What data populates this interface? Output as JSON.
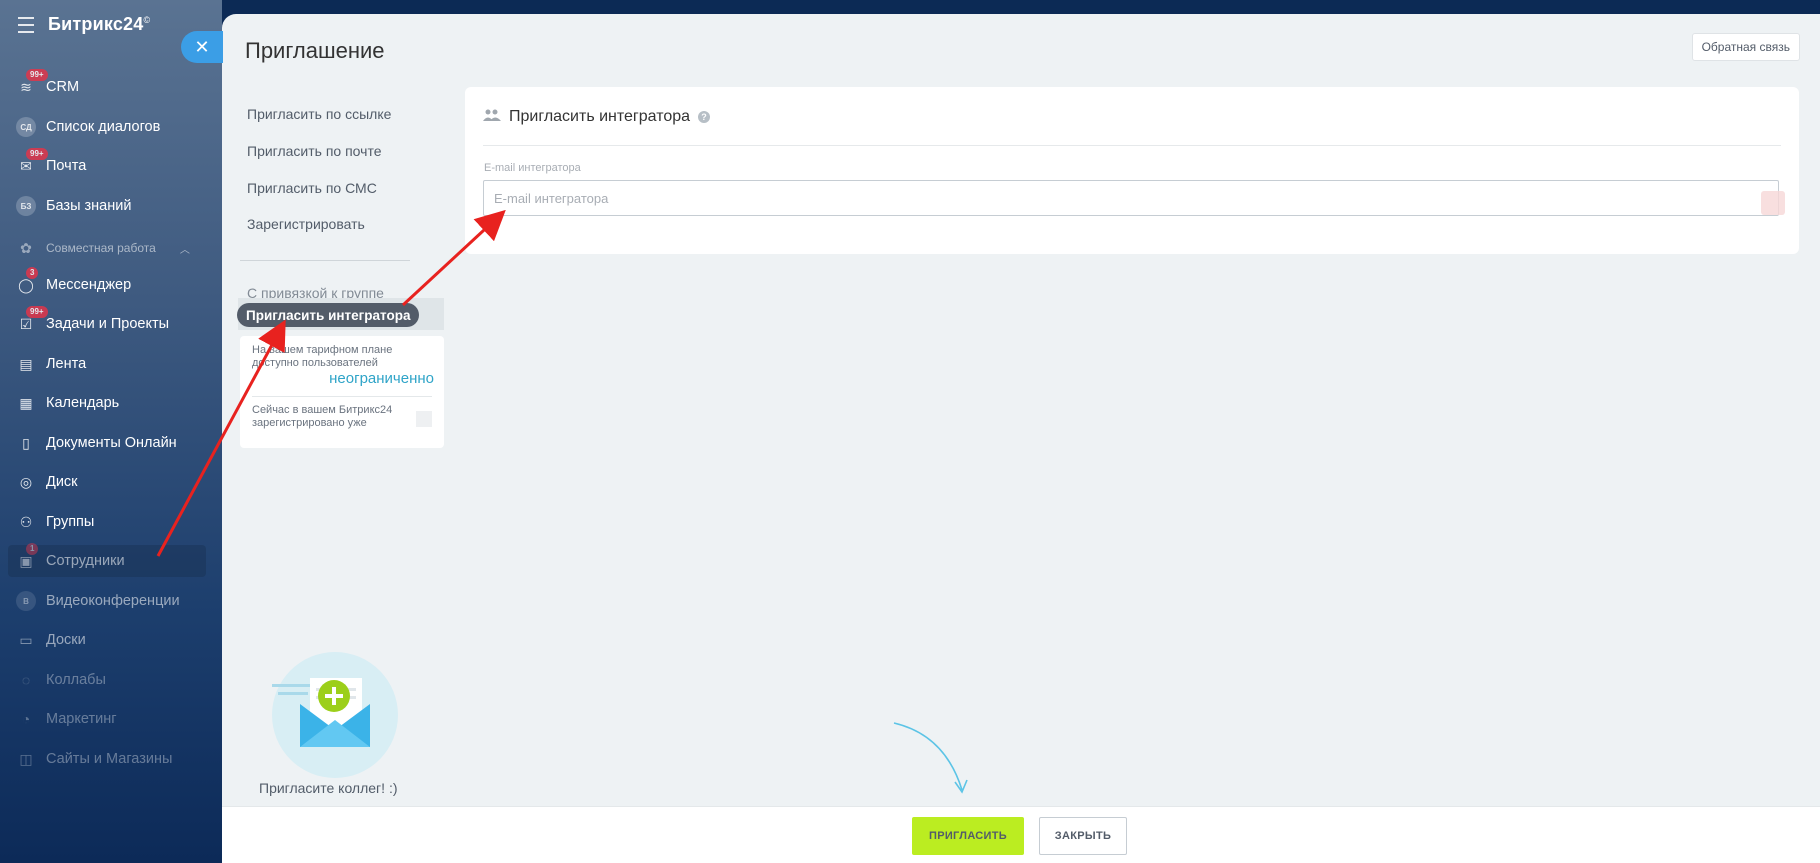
{
  "sidebar": {
    "logo": "Битрикс24",
    "logo_mark": "©",
    "items": [
      {
        "label": "CRM",
        "badge": "99+",
        "icon": "crm-icon"
      },
      {
        "label": "Список диалогов",
        "icon_text": "СД"
      },
      {
        "label": "Почта",
        "badge": "99+",
        "icon": "mail-icon"
      },
      {
        "label": "Базы знаний",
        "icon_text": "БЗ"
      },
      {
        "label": "Совместная работа",
        "type": "group"
      },
      {
        "label": "Мессенджер",
        "badge": "3",
        "icon": "chat-icon"
      },
      {
        "label": "Задачи и Проекты",
        "badge": "99+",
        "icon": "tasks-icon"
      },
      {
        "label": "Лента",
        "icon": "feed-icon"
      },
      {
        "label": "Календарь",
        "icon": "calendar-icon"
      },
      {
        "label": "Документы Онлайн",
        "icon": "documents-icon"
      },
      {
        "label": "Диск",
        "icon": "disk-icon"
      },
      {
        "label": "Группы",
        "icon": "groups-icon"
      },
      {
        "label": "Сотрудники",
        "badge": "1",
        "icon": "employees-icon"
      },
      {
        "label": "Видеоконференции",
        "icon": "video-icon"
      },
      {
        "label": "Доски",
        "icon": "boards-icon"
      },
      {
        "label": "Коллабы",
        "icon": "collabs-icon"
      },
      {
        "label": "Маркетинг",
        "icon": "marketing-icon"
      },
      {
        "label": "Сайты и Магазины",
        "icon": "sites-icon"
      }
    ]
  },
  "slider": {
    "title": "Приглашение",
    "feedback_label": "Обратная связь",
    "menu": {
      "items": [
        "Пригласить по ссылке",
        "Пригласить по почте",
        "Пригласить по СМС",
        "Зарегистрировать"
      ],
      "group_item": "С привязкой к группе",
      "active_item": "Пригласить интегратора"
    },
    "info": {
      "plan_text": "На вашем тарифном плане доступно пользователей",
      "plan_value": "неограниченно",
      "registered_text": "Сейчас в вашем Битрикс24 зарегистрировано уже"
    },
    "illustration_caption": "Пригласите коллег! :)",
    "card": {
      "title": "Пригласить интегратора",
      "help": "?",
      "field_label": "E-mail интегратора",
      "field_placeholder": "E-mail интегратора",
      "field_value": ""
    },
    "footer": {
      "invite_label": "ПРИГЛАСИТЬ",
      "close_label": "ЗАКРЫТЬ"
    }
  },
  "colors": {
    "accent_green": "#bbed21",
    "link_blue": "#2fa4c8",
    "close_button": "#3b9ee6",
    "annotation_arrow": "#e8221f"
  }
}
